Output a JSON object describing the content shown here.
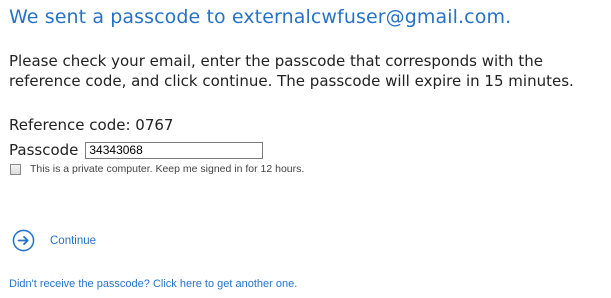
{
  "header": {
    "title": "We sent a passcode to externalcwfuser@gmail.com."
  },
  "instructions": "Please check your email, enter the passcode that corresponds with the reference code, and click continue. The passcode will expire in 15 minutes.",
  "reference": {
    "text": "Reference code: 0767"
  },
  "passcode": {
    "label": "Passcode",
    "value": "34343068"
  },
  "keep_signed_in": {
    "label": "This is a private computer. Keep me signed in for 12 hours.",
    "checked": false
  },
  "continue": {
    "label": "Continue",
    "icon": "arrow-right-circle-icon"
  },
  "resend": {
    "label": "Didn't receive the passcode? Click here to get another one."
  },
  "colors": {
    "accent": "#2672c9",
    "text": "#222222"
  }
}
